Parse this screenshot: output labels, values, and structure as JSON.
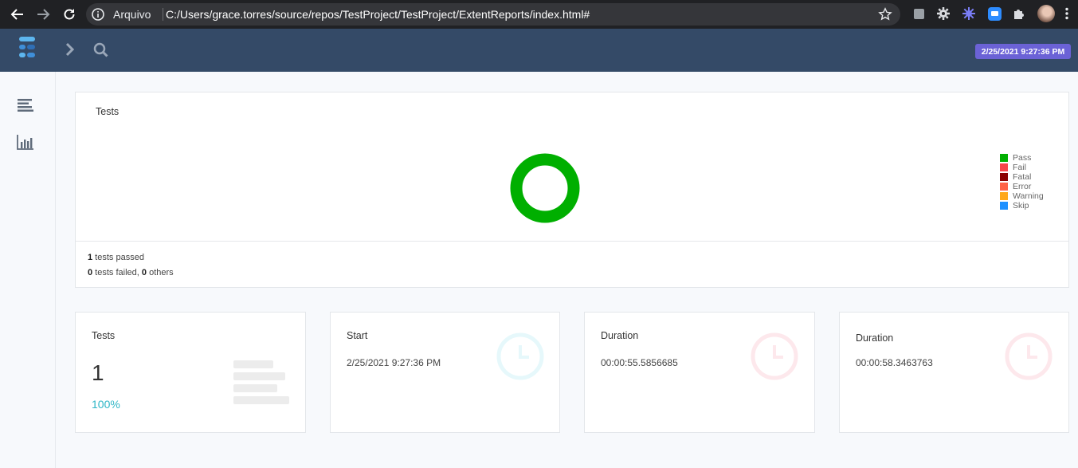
{
  "browser": {
    "site_label": "Arquivo",
    "url": "C:/Users/grace.torres/source/repos/TestProject/TestProject/ExtentReports/index.html#"
  },
  "header": {
    "date": "2/25/2021 9:27:36 PM"
  },
  "tests_chart": {
    "title": "Tests",
    "summary_passed_count": "1",
    "summary_passed_text": " tests passed",
    "summary_failed_count": "0",
    "summary_failed_text": " tests failed, ",
    "summary_others_count": "0",
    "summary_others_text": " others",
    "legend": [
      {
        "label": "Pass",
        "color": "#00af00"
      },
      {
        "label": "Fail",
        "color": "#f7464a"
      },
      {
        "label": "Fatal",
        "color": "#8b0000"
      },
      {
        "label": "Error",
        "color": "#ff6347"
      },
      {
        "label": "Warning",
        "color": "#ffa81c"
      },
      {
        "label": "Skip",
        "color": "#1e90ff"
      }
    ]
  },
  "chart_data": {
    "type": "pie",
    "categories": [
      "Pass",
      "Fail",
      "Fatal",
      "Error",
      "Warning",
      "Skip"
    ],
    "values": [
      1,
      0,
      0,
      0,
      0,
      0
    ],
    "title": "Tests",
    "legend": "right"
  },
  "cards": {
    "tests": {
      "title": "Tests",
      "count": "1",
      "percent": "100%"
    },
    "start": {
      "title": "Start",
      "value": "2/25/2021 9:27:36 PM"
    },
    "duration1": {
      "title": "Duration",
      "value": "00:00:55.5856685"
    },
    "duration2": {
      "title": "Duration",
      "value": "00:00:58.3463763"
    }
  },
  "colors": {
    "header_bg": "#344a67",
    "badge_bg": "#6b62d6",
    "pass_green": "#00af00",
    "percent_teal": "#2fb6c6"
  }
}
